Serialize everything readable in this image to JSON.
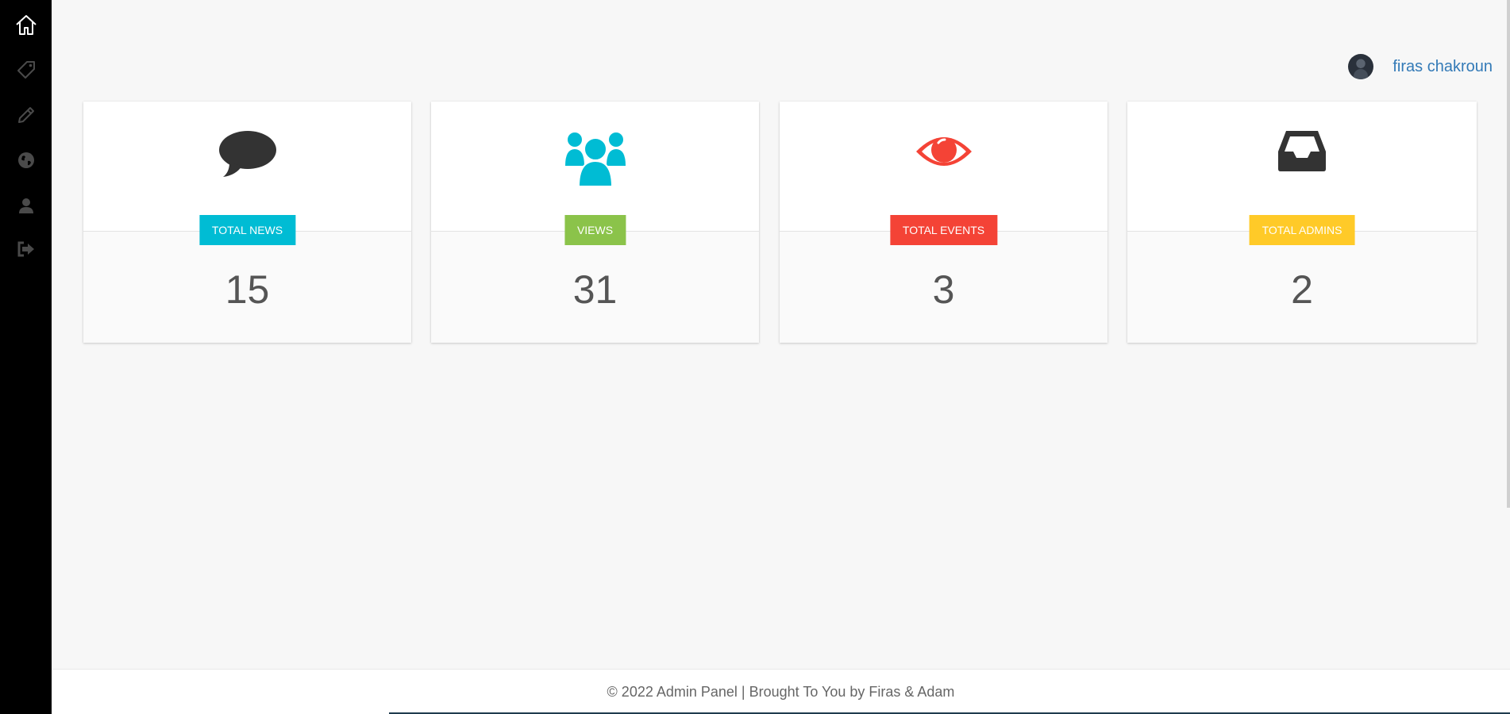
{
  "user": {
    "name": "firas chakroun"
  },
  "sidebar": {
    "items": [
      {
        "icon": "home-icon",
        "active": true
      },
      {
        "icon": "tag-icon",
        "active": false
      },
      {
        "icon": "pencil-icon",
        "active": false
      },
      {
        "icon": "globe-icon",
        "active": false
      },
      {
        "icon": "user-icon",
        "active": false
      },
      {
        "icon": "logout-icon",
        "active": false
      }
    ]
  },
  "cards": [
    {
      "label": "TOTAL NEWS",
      "value": "15",
      "icon": "comment-icon",
      "icon_color": "#333333",
      "badge_color": "#00bcd4"
    },
    {
      "label": "VIEWS",
      "value": "31",
      "icon": "users-icon",
      "icon_color": "#00bcd4",
      "badge_color": "#8bc34a"
    },
    {
      "label": "TOTAL EVENTS",
      "value": "3",
      "icon": "eye-icon",
      "icon_color": "#f44336",
      "badge_color": "#f44336"
    },
    {
      "label": "TOTAL ADMINS",
      "value": "2",
      "icon": "inbox-icon",
      "icon_color": "#333333",
      "badge_color": "#ffca28"
    }
  ],
  "footer": {
    "text": "© 2022 Admin Panel | Brought To You by Firas & Adam"
  }
}
